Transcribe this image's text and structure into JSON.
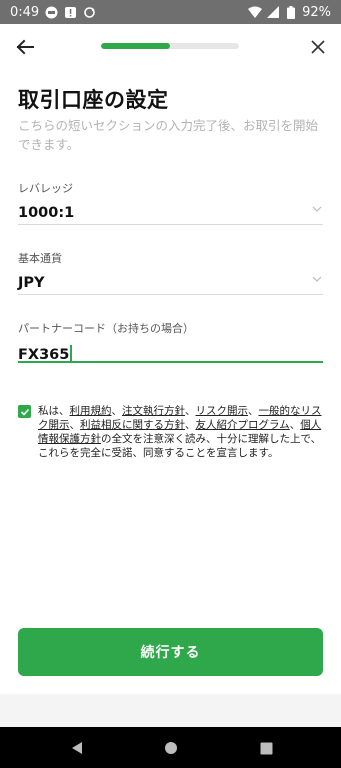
{
  "status_bar": {
    "time": "0:49",
    "battery": "92%",
    "icons": [
      "line-notification-icon",
      "alert-icon",
      "sync-icon",
      "wifi-icon",
      "signal-icon",
      "battery-icon"
    ]
  },
  "header": {
    "progress_fraction": 0.5,
    "progress_color": "#2ea84a"
  },
  "page": {
    "title": "取引口座の設定",
    "subtitle": "こちらの短いセクションの入力完了後、お取引を開始できます。"
  },
  "form": {
    "leverage": {
      "label": "レバレッジ",
      "value": "1000:1"
    },
    "base_currency": {
      "label": "基本通貨",
      "value": "JPY"
    },
    "partner_code": {
      "label": "パートナーコード（お持ちの場合）",
      "value": "FX365"
    }
  },
  "consent": {
    "checked": true,
    "parts": {
      "p0": "私は、",
      "l1": "利用規約",
      "p1": "、",
      "l2": "注文執行方針",
      "p2": "、",
      "l3": "リスク開示",
      "p3": "、",
      "l4": "一般的なリスク開示",
      "p4": "、",
      "l5": "利益相反に関する方針",
      "p5": "、",
      "l6": "友人紹介プログラム",
      "p6": "、",
      "l7": "個人情報保護方針",
      "p7": "の全文を注意深く読み、十分に理解した上で、これらを完全に受諾、同意することを宣言します。"
    }
  },
  "cta": {
    "label": "続行する"
  },
  "colors": {
    "accent": "#2ea84a",
    "status_bar_bg": "#6f6f6f",
    "nav_bar_bg": "#000000"
  }
}
